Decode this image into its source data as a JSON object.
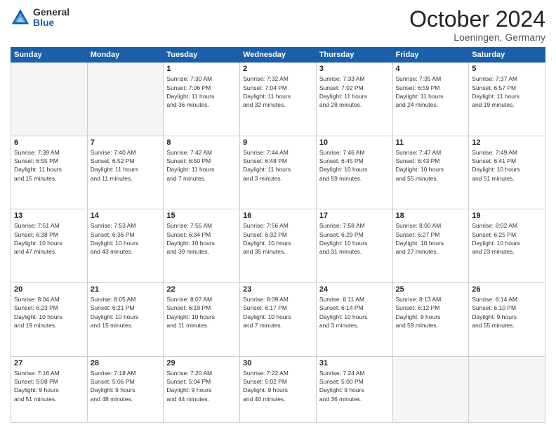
{
  "header": {
    "logo_general": "General",
    "logo_blue": "Blue",
    "month_title": "October 2024",
    "location": "Loeningen, Germany"
  },
  "weekdays": [
    "Sunday",
    "Monday",
    "Tuesday",
    "Wednesday",
    "Thursday",
    "Friday",
    "Saturday"
  ],
  "weeks": [
    [
      {
        "day": "",
        "info": ""
      },
      {
        "day": "",
        "info": ""
      },
      {
        "day": "1",
        "info": "Sunrise: 7:30 AM\nSunset: 7:06 PM\nDaylight: 11 hours\nand 36 minutes."
      },
      {
        "day": "2",
        "info": "Sunrise: 7:32 AM\nSunset: 7:04 PM\nDaylight: 11 hours\nand 32 minutes."
      },
      {
        "day": "3",
        "info": "Sunrise: 7:33 AM\nSunset: 7:02 PM\nDaylight: 11 hours\nand 28 minutes."
      },
      {
        "day": "4",
        "info": "Sunrise: 7:35 AM\nSunset: 6:59 PM\nDaylight: 11 hours\nand 24 minutes."
      },
      {
        "day": "5",
        "info": "Sunrise: 7:37 AM\nSunset: 6:57 PM\nDaylight: 11 hours\nand 19 minutes."
      }
    ],
    [
      {
        "day": "6",
        "info": "Sunrise: 7:39 AM\nSunset: 6:55 PM\nDaylight: 11 hours\nand 15 minutes."
      },
      {
        "day": "7",
        "info": "Sunrise: 7:40 AM\nSunset: 6:52 PM\nDaylight: 11 hours\nand 11 minutes."
      },
      {
        "day": "8",
        "info": "Sunrise: 7:42 AM\nSunset: 6:50 PM\nDaylight: 11 hours\nand 7 minutes."
      },
      {
        "day": "9",
        "info": "Sunrise: 7:44 AM\nSunset: 6:48 PM\nDaylight: 11 hours\nand 3 minutes."
      },
      {
        "day": "10",
        "info": "Sunrise: 7:46 AM\nSunset: 6:45 PM\nDaylight: 10 hours\nand 59 minutes."
      },
      {
        "day": "11",
        "info": "Sunrise: 7:47 AM\nSunset: 6:43 PM\nDaylight: 10 hours\nand 55 minutes."
      },
      {
        "day": "12",
        "info": "Sunrise: 7:49 AM\nSunset: 6:41 PM\nDaylight: 10 hours\nand 51 minutes."
      }
    ],
    [
      {
        "day": "13",
        "info": "Sunrise: 7:51 AM\nSunset: 6:38 PM\nDaylight: 10 hours\nand 47 minutes."
      },
      {
        "day": "14",
        "info": "Sunrise: 7:53 AM\nSunset: 6:36 PM\nDaylight: 10 hours\nand 43 minutes."
      },
      {
        "day": "15",
        "info": "Sunrise: 7:55 AM\nSunset: 6:34 PM\nDaylight: 10 hours\nand 39 minutes."
      },
      {
        "day": "16",
        "info": "Sunrise: 7:56 AM\nSunset: 6:32 PM\nDaylight: 10 hours\nand 35 minutes."
      },
      {
        "day": "17",
        "info": "Sunrise: 7:58 AM\nSunset: 6:29 PM\nDaylight: 10 hours\nand 31 minutes."
      },
      {
        "day": "18",
        "info": "Sunrise: 8:00 AM\nSunset: 6:27 PM\nDaylight: 10 hours\nand 27 minutes."
      },
      {
        "day": "19",
        "info": "Sunrise: 8:02 AM\nSunset: 6:25 PM\nDaylight: 10 hours\nand 23 minutes."
      }
    ],
    [
      {
        "day": "20",
        "info": "Sunrise: 8:04 AM\nSunset: 6:23 PM\nDaylight: 10 hours\nand 19 minutes."
      },
      {
        "day": "21",
        "info": "Sunrise: 8:05 AM\nSunset: 6:21 PM\nDaylight: 10 hours\nand 15 minutes."
      },
      {
        "day": "22",
        "info": "Sunrise: 8:07 AM\nSunset: 6:19 PM\nDaylight: 10 hours\nand 11 minutes."
      },
      {
        "day": "23",
        "info": "Sunrise: 8:09 AM\nSunset: 6:17 PM\nDaylight: 10 hours\nand 7 minutes."
      },
      {
        "day": "24",
        "info": "Sunrise: 8:11 AM\nSunset: 6:14 PM\nDaylight: 10 hours\nand 3 minutes."
      },
      {
        "day": "25",
        "info": "Sunrise: 8:13 AM\nSunset: 6:12 PM\nDaylight: 9 hours\nand 59 minutes."
      },
      {
        "day": "26",
        "info": "Sunrise: 8:14 AM\nSunset: 6:10 PM\nDaylight: 9 hours\nand 55 minutes."
      }
    ],
    [
      {
        "day": "27",
        "info": "Sunrise: 7:16 AM\nSunset: 5:08 PM\nDaylight: 9 hours\nand 51 minutes."
      },
      {
        "day": "28",
        "info": "Sunrise: 7:18 AM\nSunset: 5:06 PM\nDaylight: 9 hours\nand 48 minutes."
      },
      {
        "day": "29",
        "info": "Sunrise: 7:20 AM\nSunset: 5:04 PM\nDaylight: 9 hours\nand 44 minutes."
      },
      {
        "day": "30",
        "info": "Sunrise: 7:22 AM\nSunset: 5:02 PM\nDaylight: 9 hours\nand 40 minutes."
      },
      {
        "day": "31",
        "info": "Sunrise: 7:24 AM\nSunset: 5:00 PM\nDaylight: 9 hours\nand 36 minutes."
      },
      {
        "day": "",
        "info": ""
      },
      {
        "day": "",
        "info": ""
      }
    ]
  ]
}
